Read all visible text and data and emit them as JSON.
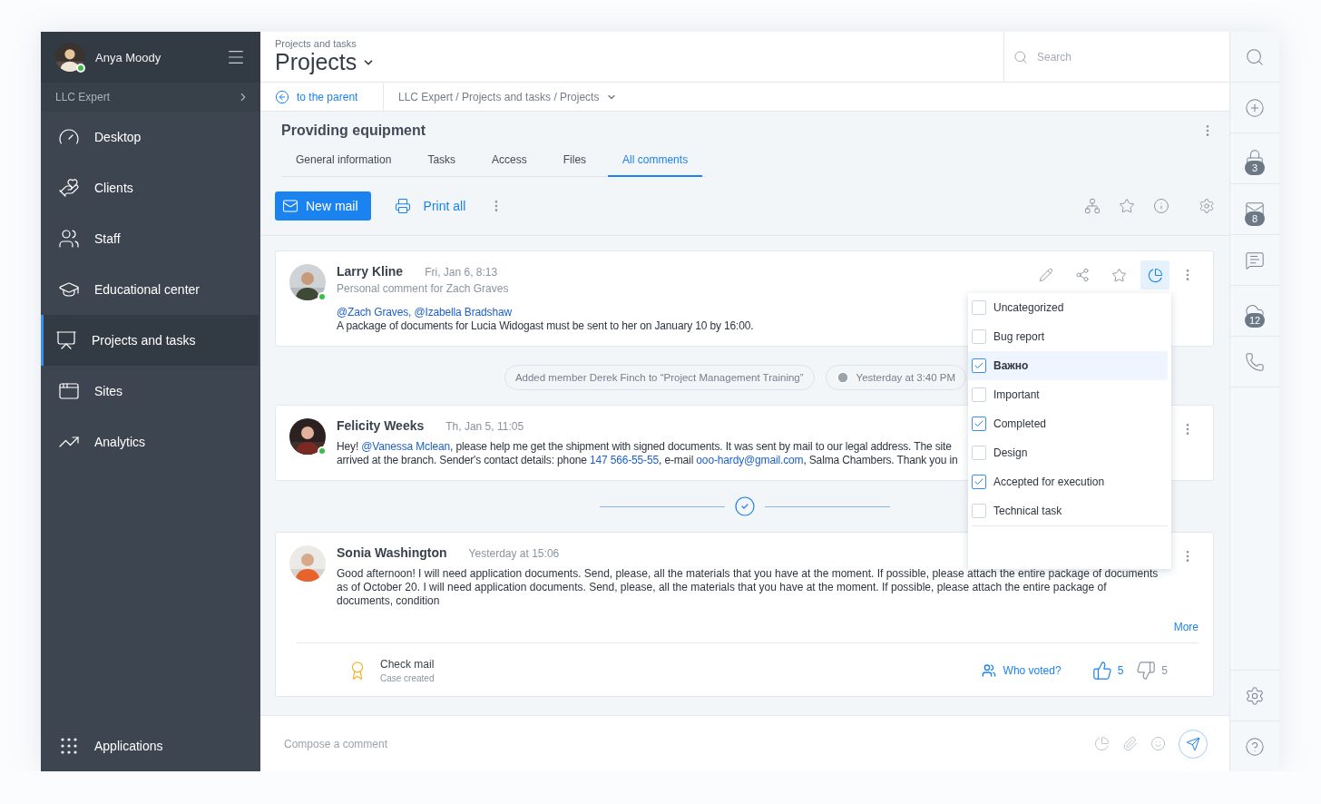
{
  "user": {
    "name": "Anya Moody",
    "online": true
  },
  "org": {
    "label": "LLC Expert"
  },
  "nav": [
    {
      "label": "Desktop",
      "selected": false
    },
    {
      "label": "Clients",
      "selected": false
    },
    {
      "label": "Staff",
      "selected": false
    },
    {
      "label": "Educational center",
      "selected": false
    },
    {
      "label": "Projects and tasks",
      "selected": true
    },
    {
      "label": "Sites",
      "selected": false
    },
    {
      "label": "Analytics",
      "selected": false
    }
  ],
  "apps": {
    "label": "Applications"
  },
  "header": {
    "section": "Projects and tasks",
    "title": "Projects"
  },
  "search": {
    "placeholder": "Search"
  },
  "back": {
    "label": "to the parent"
  },
  "path": "LLC Expert / Projects and tasks / Projects",
  "record": {
    "title": "Providing equipment"
  },
  "tabs": [
    {
      "label": "General information",
      "selected": false
    },
    {
      "label": "Tasks",
      "selected": false
    },
    {
      "label": "Access",
      "selected": false
    },
    {
      "label": "Files",
      "selected": false
    },
    {
      "label": "All comments",
      "selected": true
    }
  ],
  "toolbar": {
    "new_mail": "New mail",
    "print": "Print all"
  },
  "feed": [
    {
      "kind": "comment",
      "author": "Larry Kline",
      "time": "Fri, Jan 6, 8:13",
      "online": true,
      "subtitle": "Personal comment for Zach Graves",
      "categories_open": true,
      "lines": [
        [
          {
            "text": "@Zach Graves, @Izabella Bradshaw",
            "link": true
          }
        ],
        [
          {
            "text": "A package of documents for Lucia Widogast must be sent to her on January 10 by 16:00.",
            "link": false
          }
        ]
      ]
    },
    {
      "kind": "event",
      "text": "Added member Derek Finch to “Project Management Training”",
      "time": "Yesterday at 3:40 PM"
    },
    {
      "kind": "comment",
      "author": "Felicity Weeks",
      "time": "Th, Jan 5, 11:05",
      "online": true,
      "categories_open": false,
      "lines": [
        [
          {
            "text": "Hey! ",
            "link": false
          },
          {
            "text": "@Vanessa Mclean",
            "link": true
          },
          {
            "text": ", please help me get the shipment with signed documents. It was sent by mail to our legal address. The site",
            "link": false
          }
        ],
        [
          {
            "text": "arrived at the branch. Sender's contact details: phone ",
            "link": false
          },
          {
            "text": "147 566-55-55",
            "link": true
          },
          {
            "text": ", e-mail ",
            "link": false
          },
          {
            "text": "ooo-hardy@gmail.com",
            "link": true
          },
          {
            "text": ", Salma Chambers. Thank you in",
            "link": false
          }
        ]
      ]
    },
    {
      "kind": "divider"
    },
    {
      "kind": "comment",
      "author": "Sonia Washington",
      "time": "Yesterday at 15:06",
      "online": false,
      "categories_open": false,
      "paragraph": "Good afternoon! I will need application documents. Send, please, all the materials that you have at the moment. If possible, please attach the entire package of documents as of October 20. I will need application documents. Send, please, all the materials that you have at the moment. If possible, please attach the entire package of documents, condition",
      "more": "More",
      "footer": {
        "title": "Check mail",
        "subtitle": "Case created",
        "who_voted": "Who voted?",
        "likes": "5",
        "dislikes": "5"
      }
    }
  ],
  "category_menu": {
    "items": [
      {
        "label": "Uncategorized",
        "checked": false,
        "selected": false
      },
      {
        "label": "Bug report",
        "checked": false,
        "selected": false
      },
      {
        "label": "Важно",
        "checked": true,
        "selected": true
      },
      {
        "label": "Important",
        "checked": false,
        "selected": false
      },
      {
        "label": "Completed",
        "checked": true,
        "selected": false
      },
      {
        "label": "Design",
        "checked": false,
        "selected": false
      },
      {
        "label": "Accepted for execution",
        "checked": true,
        "selected": false
      },
      {
        "label": "Technical task",
        "checked": false,
        "selected": false
      }
    ]
  },
  "compose": {
    "placeholder": "Compose a comment"
  },
  "rail_badges": [
    "3",
    "8",
    "12"
  ]
}
